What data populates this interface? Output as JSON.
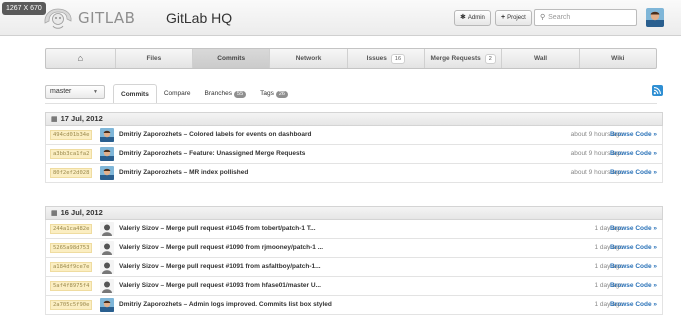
{
  "window": {
    "dimensions_badge": "1267 X 670"
  },
  "header": {
    "logo_text": "GITLAB",
    "project_title": "GitLab HQ",
    "admin_label": "Admin",
    "project_label": "Project",
    "search_placeholder": "Search",
    "icons": {
      "admin": "gear-icon",
      "project": "plus-icon",
      "search": "search-icon"
    }
  },
  "main_nav": {
    "items": [
      {
        "label": "",
        "icon": "home-icon"
      },
      {
        "label": "Files"
      },
      {
        "label": "Commits",
        "active": true
      },
      {
        "label": "Network"
      },
      {
        "label": "Issues",
        "count": "16"
      },
      {
        "label": "Merge Requests",
        "count": "2"
      },
      {
        "label": "Wall"
      },
      {
        "label": "Wiki"
      }
    ]
  },
  "sub_nav": {
    "branch": "master",
    "tabs": [
      {
        "label": "Commits",
        "active": true
      },
      {
        "label": "Compare"
      },
      {
        "label": "Branches",
        "count": "55"
      },
      {
        "label": "Tags",
        "count": "26"
      }
    ],
    "rss_icon": "rss-icon"
  },
  "groups": [
    {
      "date": "17 Jul, 2012",
      "commits": [
        {
          "sha": "494cd01b34e",
          "author": "Dmitriy Zaporozhets",
          "message": "Colored labels for events on dashboard",
          "time": "about 9 hours ago",
          "browse": "Browse Code »"
        },
        {
          "sha": "a3bb3ca1fa2",
          "author": "Dmitriy Zaporozhets",
          "message": "Feature: Unassigned Merge Requests",
          "time": "about 9 hours ago",
          "browse": "Browse Code »"
        },
        {
          "sha": "80f2ef2d028",
          "author": "Dmitriy Zaporozhets",
          "message": "MR index pollished",
          "time": "about 9 hours ago",
          "browse": "Browse Code »"
        }
      ]
    },
    {
      "date": "16 Jul, 2012",
      "commits": [
        {
          "sha": "244a1ca482e",
          "author": "Valeriy Sizov",
          "message": "Merge pull request #1045 from tobert/patch-1 T...",
          "time": "1 day ago",
          "browse": "Browse Code »"
        },
        {
          "sha": "5265a98d753",
          "author": "Valeriy Sizov",
          "message": "Merge pull request #1090 from rjmooney/patch-1 ...",
          "time": "1 day ago",
          "browse": "Browse Code »"
        },
        {
          "sha": "a184df9ce7e",
          "author": "Valeriy Sizov",
          "message": "Merge pull request #1091 from asfaltboy/patch-1...",
          "time": "1 day ago",
          "browse": "Browse Code »"
        },
        {
          "sha": "5af4f8975f4",
          "author": "Valeriy Sizov",
          "message": "Merge pull request #1093 from hfase01/master U...",
          "time": "1 day ago",
          "browse": "Browse Code »"
        },
        {
          "sha": "2a705c5f90e",
          "author": "Dmitriy Zaporozhets",
          "message": "Admin logs improved. Commits list box styled",
          "time": "1 day ago",
          "browse": "Browse Code »"
        }
      ]
    }
  ],
  "separator": " – "
}
